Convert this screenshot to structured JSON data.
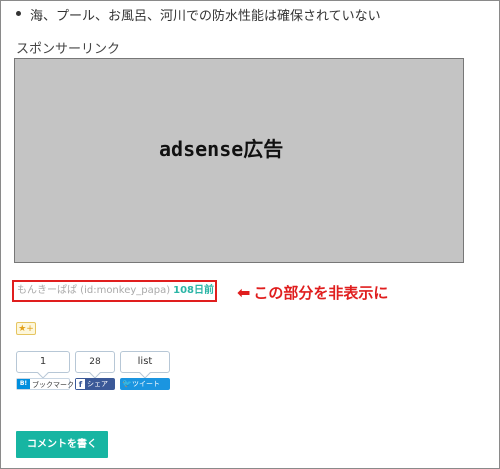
{
  "content": {
    "bullet_text": "海、プール、お風呂、河川での防水性能は確保されていない",
    "sponsor_label": "スポンサーリンク",
    "ad_text": "adsense広告"
  },
  "byline": {
    "author": "もんきーぱぱ (id:monkey_papa)",
    "days": "108日前"
  },
  "annotation": {
    "arrow": "⬅",
    "text": "この部分を非表示に"
  },
  "star_button": {
    "label": "★+"
  },
  "share": {
    "hatena_count": "1",
    "facebook_count": "28",
    "twitter_count": "list",
    "hatena_icon": "B!",
    "hatena_label": "ブックマーク",
    "facebook_icon": "f",
    "facebook_label": "シェア",
    "twitter_icon": "🐦",
    "twitter_label": "ツイート"
  },
  "comment_button": {
    "label": "コメントを書く"
  },
  "colors": {
    "accent_red": "#e01e1e",
    "teal": "#17b5a2",
    "ad_gray": "#c4c4c4",
    "facebook": "#3b5998",
    "twitter": "#1b95e0",
    "hatena": "#008fde"
  }
}
